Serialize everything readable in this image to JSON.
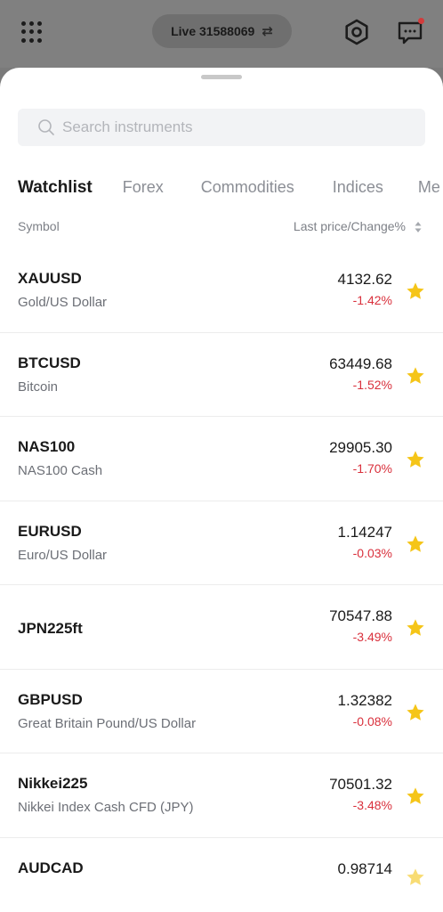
{
  "topbar": {
    "account_label": "Live 31588069"
  },
  "search": {
    "placeholder": "Search instruments"
  },
  "tabs": [
    {
      "label": "Watchlist"
    },
    {
      "label": "Forex"
    },
    {
      "label": "Commodities"
    },
    {
      "label": "Indices"
    },
    {
      "label": "Me"
    }
  ],
  "list_header": {
    "symbol": "Symbol",
    "last_price": "Last price/Change%"
  },
  "instruments": [
    {
      "symbol": "XAUUSD",
      "description": "Gold/US Dollar",
      "price": "4132.62",
      "change": "-1.42%"
    },
    {
      "symbol": "BTCUSD",
      "description": "Bitcoin",
      "price": "63449.68",
      "change": "-1.52%"
    },
    {
      "symbol": "NAS100",
      "description": "NAS100 Cash",
      "price": "29905.30",
      "change": "-1.70%"
    },
    {
      "symbol": "EURUSD",
      "description": "Euro/US Dollar",
      "price": "1.14247",
      "change": "-0.03%"
    },
    {
      "symbol": "JPN225ft",
      "description": "",
      "price": "70547.88",
      "change": "-3.49%"
    },
    {
      "symbol": "GBPUSD",
      "description": "Great Britain Pound/US Dollar",
      "price": "1.32382",
      "change": "-0.08%"
    },
    {
      "symbol": "Nikkei225",
      "description": "Nikkei Index Cash CFD (JPY)",
      "price": "70501.32",
      "change": "-3.48%"
    },
    {
      "symbol": "AUDCAD",
      "description": "",
      "price": "0.98714",
      "change": ""
    }
  ],
  "colors": {
    "negative": "#d9303c",
    "star": "#f5c518",
    "notification_dot": "#d23b3b"
  }
}
